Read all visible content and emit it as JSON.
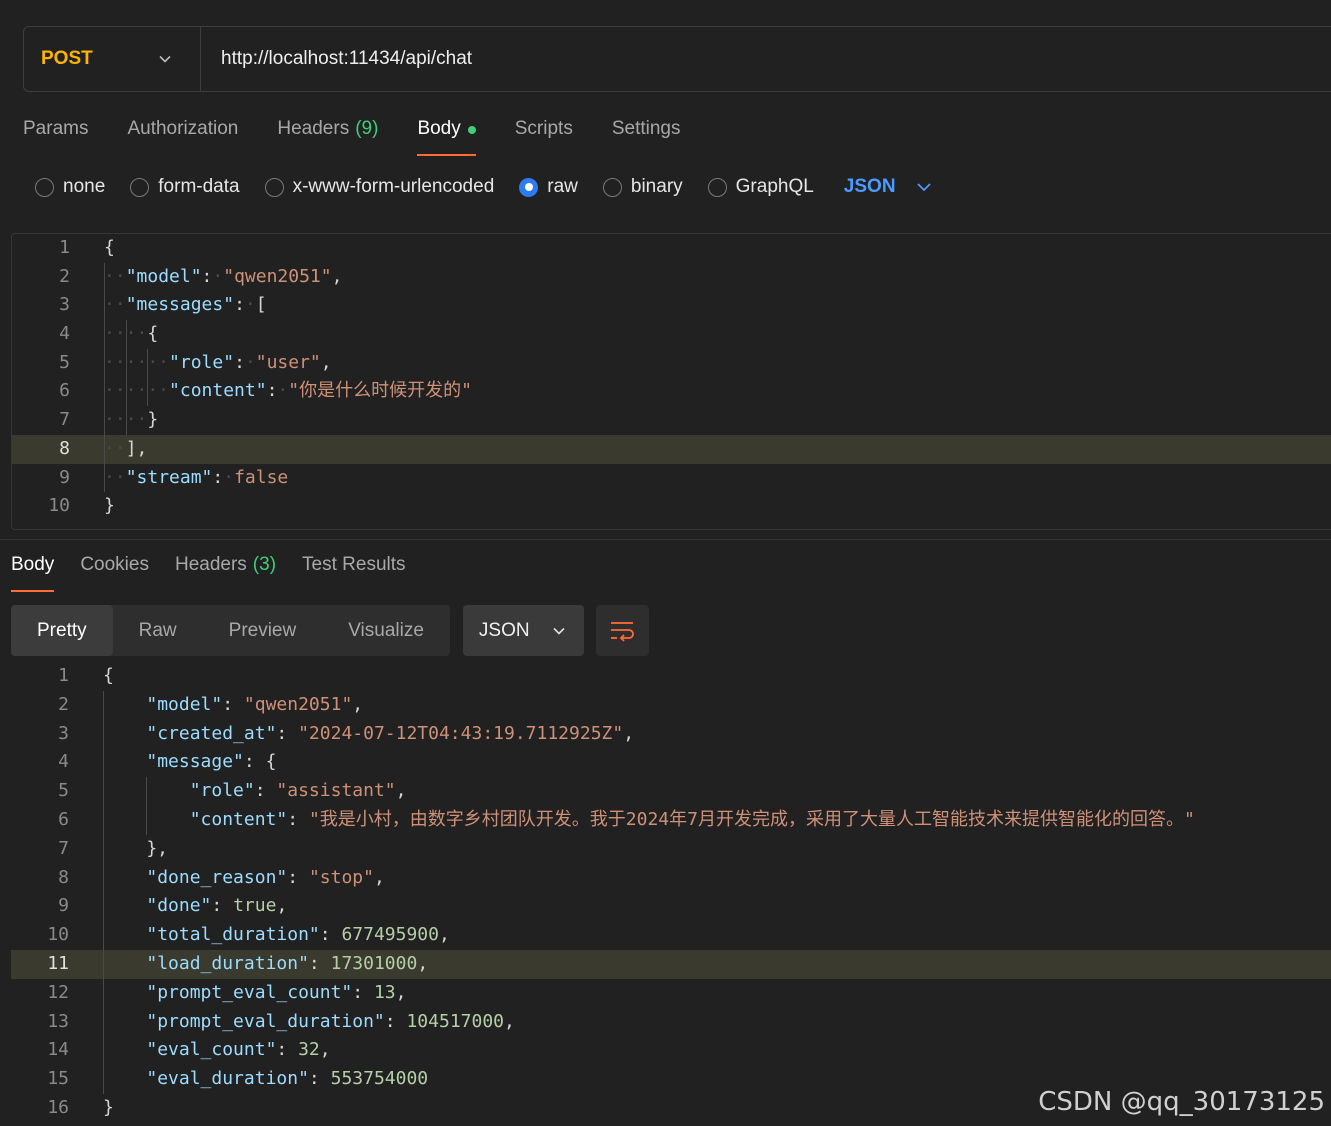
{
  "request": {
    "method": "POST",
    "url": "http://localhost:11434/api/chat",
    "tabs": [
      {
        "label": "Params",
        "count": "",
        "active": false
      },
      {
        "label": "Authorization",
        "count": "",
        "active": false
      },
      {
        "label": "Headers",
        "count": "(9)",
        "active": false
      },
      {
        "label": "Body",
        "count": "",
        "active": true
      },
      {
        "label": "Scripts",
        "count": "",
        "active": false
      },
      {
        "label": "Settings",
        "count": "",
        "active": false
      }
    ],
    "body_types": [
      "none",
      "form-data",
      "x-www-form-urlencoded",
      "raw",
      "binary",
      "GraphQL"
    ],
    "selected_body_type": "raw",
    "format": "JSON",
    "code_lines": [
      "{",
      "  \"model\": \"qwen2051\",",
      "  \"messages\": [",
      "    {",
      "      \"role\": \"user\",",
      "      \"content\": \"你是什么时候开发的\"",
      "    }",
      "  ],",
      "  \"stream\": false",
      "}"
    ],
    "highlighted_line": 8
  },
  "response": {
    "tabs": [
      {
        "label": "Body",
        "count": "",
        "active": true
      },
      {
        "label": "Cookies",
        "count": "",
        "active": false
      },
      {
        "label": "Headers",
        "count": "(3)",
        "active": false
      },
      {
        "label": "Test Results",
        "count": "",
        "active": false
      }
    ],
    "views": [
      "Pretty",
      "Raw",
      "Preview",
      "Visualize"
    ],
    "active_view": "Pretty",
    "format": "JSON",
    "code_lines": [
      "{",
      "    \"model\": \"qwen2051\",",
      "    \"created_at\": \"2024-07-12T04:43:19.7112925Z\",",
      "    \"message\": {",
      "        \"role\": \"assistant\",",
      "        \"content\": \"我是小村，由数字乡村团队开发。我于2024年7月开发完成，采用了大量人工智能技术来提供智能化的回答。\"",
      "    },",
      "    \"done_reason\": \"stop\",",
      "    \"done\": true,",
      "    \"total_duration\": 677495900,",
      "    \"load_duration\": 17301000,",
      "    \"prompt_eval_count\": 13,",
      "    \"prompt_eval_duration\": 104517000,",
      "    \"eval_count\": 32,",
      "    \"eval_duration\": 553754000",
      "}"
    ],
    "highlighted_line": 11
  },
  "watermark": "CSDN @qq_30173125",
  "colors": {
    "method": "#ffb400",
    "accent": "#ff6c37",
    "count": "#3ecf78",
    "radio_selected": "#2d7cf6",
    "json_link": "#4c9aff",
    "key": "#9cdcfe",
    "string": "#ce9178",
    "number": "#b5cea8"
  },
  "icons": {
    "method_dropdown": "chevron-down-icon",
    "format_dropdown": "chevron-down-icon",
    "wrap": "wrap-lines-icon"
  }
}
